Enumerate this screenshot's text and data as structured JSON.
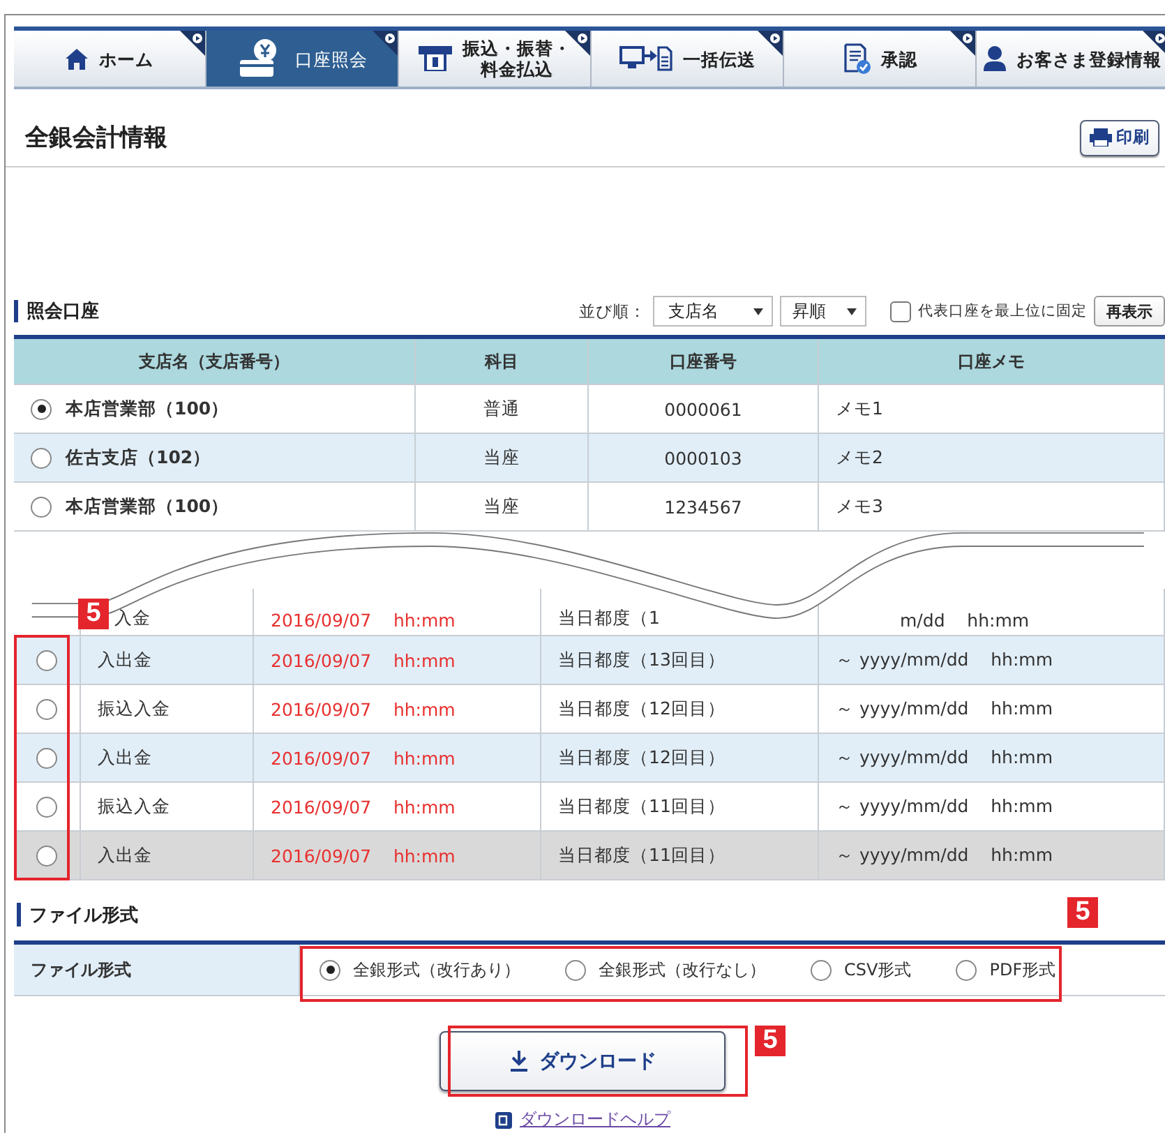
{
  "nav": {
    "tabs": [
      {
        "label": "ホーム",
        "kind": "home",
        "selected": false
      },
      {
        "label": "口座照会",
        "kind": "account",
        "selected": true
      },
      {
        "label": "振込・振替・料金払込",
        "kind": "transfer",
        "selected": false
      },
      {
        "label": "一括伝送",
        "kind": "batch",
        "selected": false
      },
      {
        "label": "承認",
        "kind": "approval",
        "selected": false
      },
      {
        "label": "お客さま登録情報",
        "kind": "profile",
        "selected": false
      }
    ]
  },
  "page": {
    "title": "全銀会計情報",
    "print_button": "印刷"
  },
  "accounts": {
    "heading": "照会口座",
    "sort_label": "並び順：",
    "sort_key": "支店名",
    "sort_order": "昇順",
    "pin_representative": {
      "label": "代表口座を最上位に固定",
      "checked": false
    },
    "refresh_button": "再表示",
    "columns": [
      "支店名（支店番号）",
      "科目",
      "口座番号",
      "口座メモ"
    ],
    "rows": [
      {
        "branch": "本店営業部（100）",
        "subject": "普通",
        "number": "0000061",
        "memo": "メモ1",
        "selected": true
      },
      {
        "branch": "佐古支店（102）",
        "subject": "当座",
        "number": "0000103",
        "memo": "メモ2",
        "selected": false
      },
      {
        "branch": "本店営業部（100）",
        "subject": "当座",
        "number": "1234567",
        "memo": "メモ3",
        "selected": false
      }
    ]
  },
  "history": {
    "callout": "5",
    "partial_row": {
      "type": "入金",
      "date": "2016/09/07    hh:mm",
      "schedule": "当日都度（1",
      "period": "m/dd    hh:mm"
    },
    "rows": [
      {
        "type": "入出金",
        "date": "2016/09/07    hh:mm",
        "schedule": "当日都度（13回目）",
        "period": "～ yyyy/mm/dd    hh:mm",
        "selected": false,
        "highlighted": false
      },
      {
        "type": "振込入金",
        "date": "2016/09/07    hh:mm",
        "schedule": "当日都度（12回目）",
        "period": "～ yyyy/mm/dd    hh:mm",
        "selected": false,
        "highlighted": false
      },
      {
        "type": "入出金",
        "date": "2016/09/07    hh:mm",
        "schedule": "当日都度（12回目）",
        "period": "～ yyyy/mm/dd    hh:mm",
        "selected": false,
        "highlighted": false
      },
      {
        "type": "振込入金",
        "date": "2016/09/07    hh:mm",
        "schedule": "当日都度（11回目）",
        "period": "～ yyyy/mm/dd    hh:mm",
        "selected": false,
        "highlighted": false
      },
      {
        "type": "入出金",
        "date": "2016/09/07    hh:mm",
        "schedule": "当日都度（11回目）",
        "period": "～ yyyy/mm/dd    hh:mm",
        "selected": false,
        "highlighted": true
      }
    ]
  },
  "file_format": {
    "heading": "ファイル形式",
    "label": "ファイル形式",
    "callout": "5",
    "options": [
      {
        "label": "全銀形式（改行あり）",
        "selected": true
      },
      {
        "label": "全銀形式（改行なし）",
        "selected": false
      },
      {
        "label": "CSV形式",
        "selected": false
      },
      {
        "label": "PDF形式",
        "selected": false
      }
    ]
  },
  "download": {
    "button": "ダウンロード",
    "help_link": "ダウンロードヘルプ",
    "callout": "5"
  }
}
